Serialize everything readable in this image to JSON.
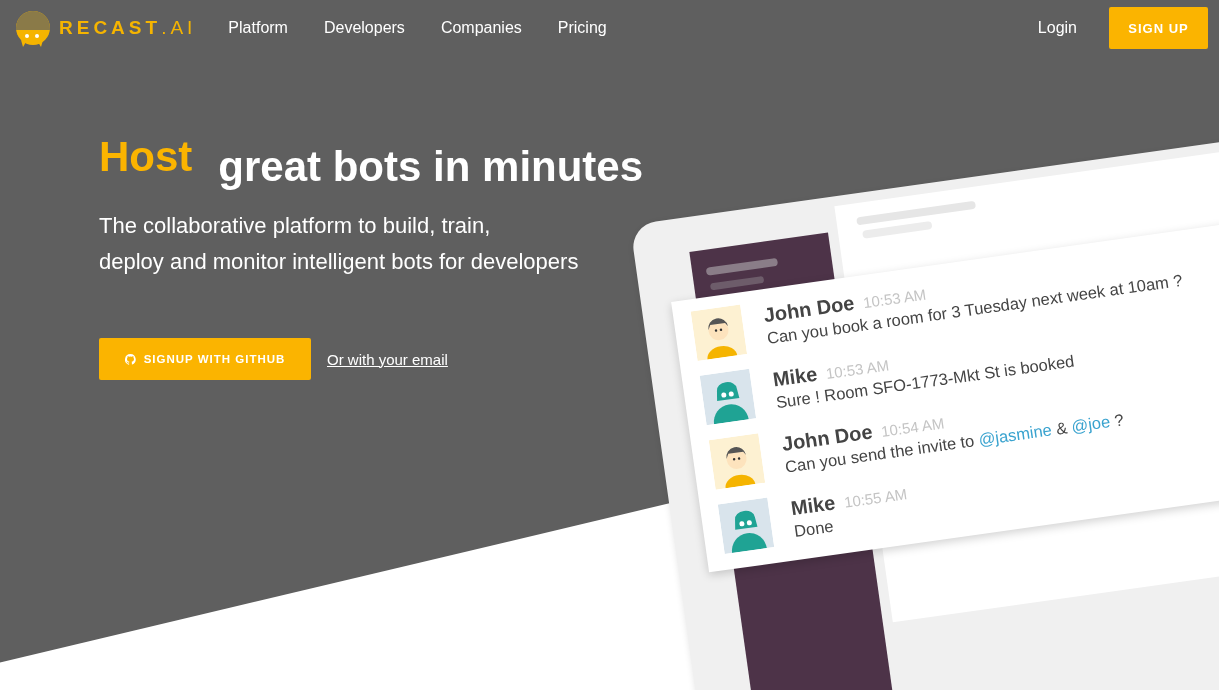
{
  "nav": {
    "logo_text": "RECAST",
    "logo_suffix": ".AI",
    "links": [
      "Platform",
      "Developers",
      "Companies",
      "Pricing"
    ],
    "login": "Login",
    "signup": "SIGN UP"
  },
  "hero": {
    "highlight": "Host",
    "title": "great bots in minutes",
    "subtitle_lines": [
      "The collaborative platform to build, train,",
      "deploy and monitor intelligent bots for developers"
    ],
    "github_button": "SIGNUP WITH GITHUB",
    "email_link": "Or with your email"
  },
  "chat": {
    "messages": [
      {
        "author": "John Doe",
        "time": "10:53 AM",
        "kind": "person",
        "parts": [
          {
            "kind": "text",
            "text": "Can you book a room for 3 Tuesday next week at 10am ?"
          }
        ]
      },
      {
        "author": "Mike",
        "time": "10:53 AM",
        "kind": "robot",
        "parts": [
          {
            "kind": "text",
            "text": "Sure ! Room SFO-1773-Mkt St is booked"
          }
        ]
      },
      {
        "author": "John Doe",
        "time": "10:54 AM",
        "kind": "person",
        "parts": [
          {
            "kind": "text",
            "text": "Can you send the invite to "
          },
          {
            "kind": "mention",
            "text": "@jasmine"
          },
          {
            "kind": "text",
            "text": " & "
          },
          {
            "kind": "mention",
            "text": "@joe"
          },
          {
            "kind": "text",
            "text": " ?"
          }
        ]
      },
      {
        "author": "Mike",
        "time": "10:55 AM",
        "kind": "robot",
        "parts": [
          {
            "kind": "text",
            "text": "Done"
          }
        ]
      }
    ]
  }
}
